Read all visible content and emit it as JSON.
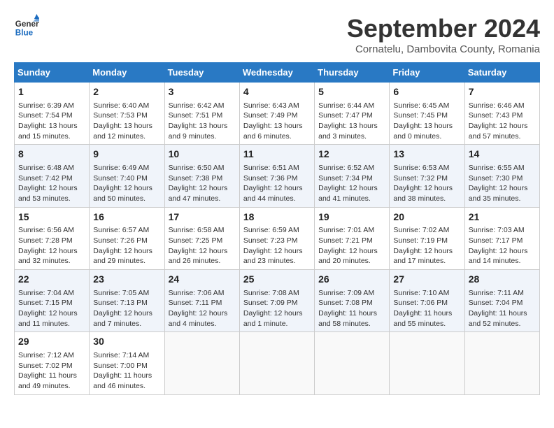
{
  "header": {
    "logo_line1": "General",
    "logo_line2": "Blue",
    "month_title": "September 2024",
    "subtitle": "Cornatelu, Dambovita County, Romania"
  },
  "weekdays": [
    "Sunday",
    "Monday",
    "Tuesday",
    "Wednesday",
    "Thursday",
    "Friday",
    "Saturday"
  ],
  "weeks": [
    [
      {
        "day": "1",
        "text": "Sunrise: 6:39 AM\nSunset: 7:54 PM\nDaylight: 13 hours\nand 15 minutes."
      },
      {
        "day": "2",
        "text": "Sunrise: 6:40 AM\nSunset: 7:53 PM\nDaylight: 13 hours\nand 12 minutes."
      },
      {
        "day": "3",
        "text": "Sunrise: 6:42 AM\nSunset: 7:51 PM\nDaylight: 13 hours\nand 9 minutes."
      },
      {
        "day": "4",
        "text": "Sunrise: 6:43 AM\nSunset: 7:49 PM\nDaylight: 13 hours\nand 6 minutes."
      },
      {
        "day": "5",
        "text": "Sunrise: 6:44 AM\nSunset: 7:47 PM\nDaylight: 13 hours\nand 3 minutes."
      },
      {
        "day": "6",
        "text": "Sunrise: 6:45 AM\nSunset: 7:45 PM\nDaylight: 13 hours\nand 0 minutes."
      },
      {
        "day": "7",
        "text": "Sunrise: 6:46 AM\nSunset: 7:43 PM\nDaylight: 12 hours\nand 57 minutes."
      }
    ],
    [
      {
        "day": "8",
        "text": "Sunrise: 6:48 AM\nSunset: 7:42 PM\nDaylight: 12 hours\nand 53 minutes."
      },
      {
        "day": "9",
        "text": "Sunrise: 6:49 AM\nSunset: 7:40 PM\nDaylight: 12 hours\nand 50 minutes."
      },
      {
        "day": "10",
        "text": "Sunrise: 6:50 AM\nSunset: 7:38 PM\nDaylight: 12 hours\nand 47 minutes."
      },
      {
        "day": "11",
        "text": "Sunrise: 6:51 AM\nSunset: 7:36 PM\nDaylight: 12 hours\nand 44 minutes."
      },
      {
        "day": "12",
        "text": "Sunrise: 6:52 AM\nSunset: 7:34 PM\nDaylight: 12 hours\nand 41 minutes."
      },
      {
        "day": "13",
        "text": "Sunrise: 6:53 AM\nSunset: 7:32 PM\nDaylight: 12 hours\nand 38 minutes."
      },
      {
        "day": "14",
        "text": "Sunrise: 6:55 AM\nSunset: 7:30 PM\nDaylight: 12 hours\nand 35 minutes."
      }
    ],
    [
      {
        "day": "15",
        "text": "Sunrise: 6:56 AM\nSunset: 7:28 PM\nDaylight: 12 hours\nand 32 minutes."
      },
      {
        "day": "16",
        "text": "Sunrise: 6:57 AM\nSunset: 7:26 PM\nDaylight: 12 hours\nand 29 minutes."
      },
      {
        "day": "17",
        "text": "Sunrise: 6:58 AM\nSunset: 7:25 PM\nDaylight: 12 hours\nand 26 minutes."
      },
      {
        "day": "18",
        "text": "Sunrise: 6:59 AM\nSunset: 7:23 PM\nDaylight: 12 hours\nand 23 minutes."
      },
      {
        "day": "19",
        "text": "Sunrise: 7:01 AM\nSunset: 7:21 PM\nDaylight: 12 hours\nand 20 minutes."
      },
      {
        "day": "20",
        "text": "Sunrise: 7:02 AM\nSunset: 7:19 PM\nDaylight: 12 hours\nand 17 minutes."
      },
      {
        "day": "21",
        "text": "Sunrise: 7:03 AM\nSunset: 7:17 PM\nDaylight: 12 hours\nand 14 minutes."
      }
    ],
    [
      {
        "day": "22",
        "text": "Sunrise: 7:04 AM\nSunset: 7:15 PM\nDaylight: 12 hours\nand 11 minutes."
      },
      {
        "day": "23",
        "text": "Sunrise: 7:05 AM\nSunset: 7:13 PM\nDaylight: 12 hours\nand 7 minutes."
      },
      {
        "day": "24",
        "text": "Sunrise: 7:06 AM\nSunset: 7:11 PM\nDaylight: 12 hours\nand 4 minutes."
      },
      {
        "day": "25",
        "text": "Sunrise: 7:08 AM\nSunset: 7:09 PM\nDaylight: 12 hours\nand 1 minute."
      },
      {
        "day": "26",
        "text": "Sunrise: 7:09 AM\nSunset: 7:08 PM\nDaylight: 11 hours\nand 58 minutes."
      },
      {
        "day": "27",
        "text": "Sunrise: 7:10 AM\nSunset: 7:06 PM\nDaylight: 11 hours\nand 55 minutes."
      },
      {
        "day": "28",
        "text": "Sunrise: 7:11 AM\nSunset: 7:04 PM\nDaylight: 11 hours\nand 52 minutes."
      }
    ],
    [
      {
        "day": "29",
        "text": "Sunrise: 7:12 AM\nSunset: 7:02 PM\nDaylight: 11 hours\nand 49 minutes."
      },
      {
        "day": "30",
        "text": "Sunrise: 7:14 AM\nSunset: 7:00 PM\nDaylight: 11 hours\nand 46 minutes."
      },
      {
        "day": "",
        "text": ""
      },
      {
        "day": "",
        "text": ""
      },
      {
        "day": "",
        "text": ""
      },
      {
        "day": "",
        "text": ""
      },
      {
        "day": "",
        "text": ""
      }
    ]
  ]
}
